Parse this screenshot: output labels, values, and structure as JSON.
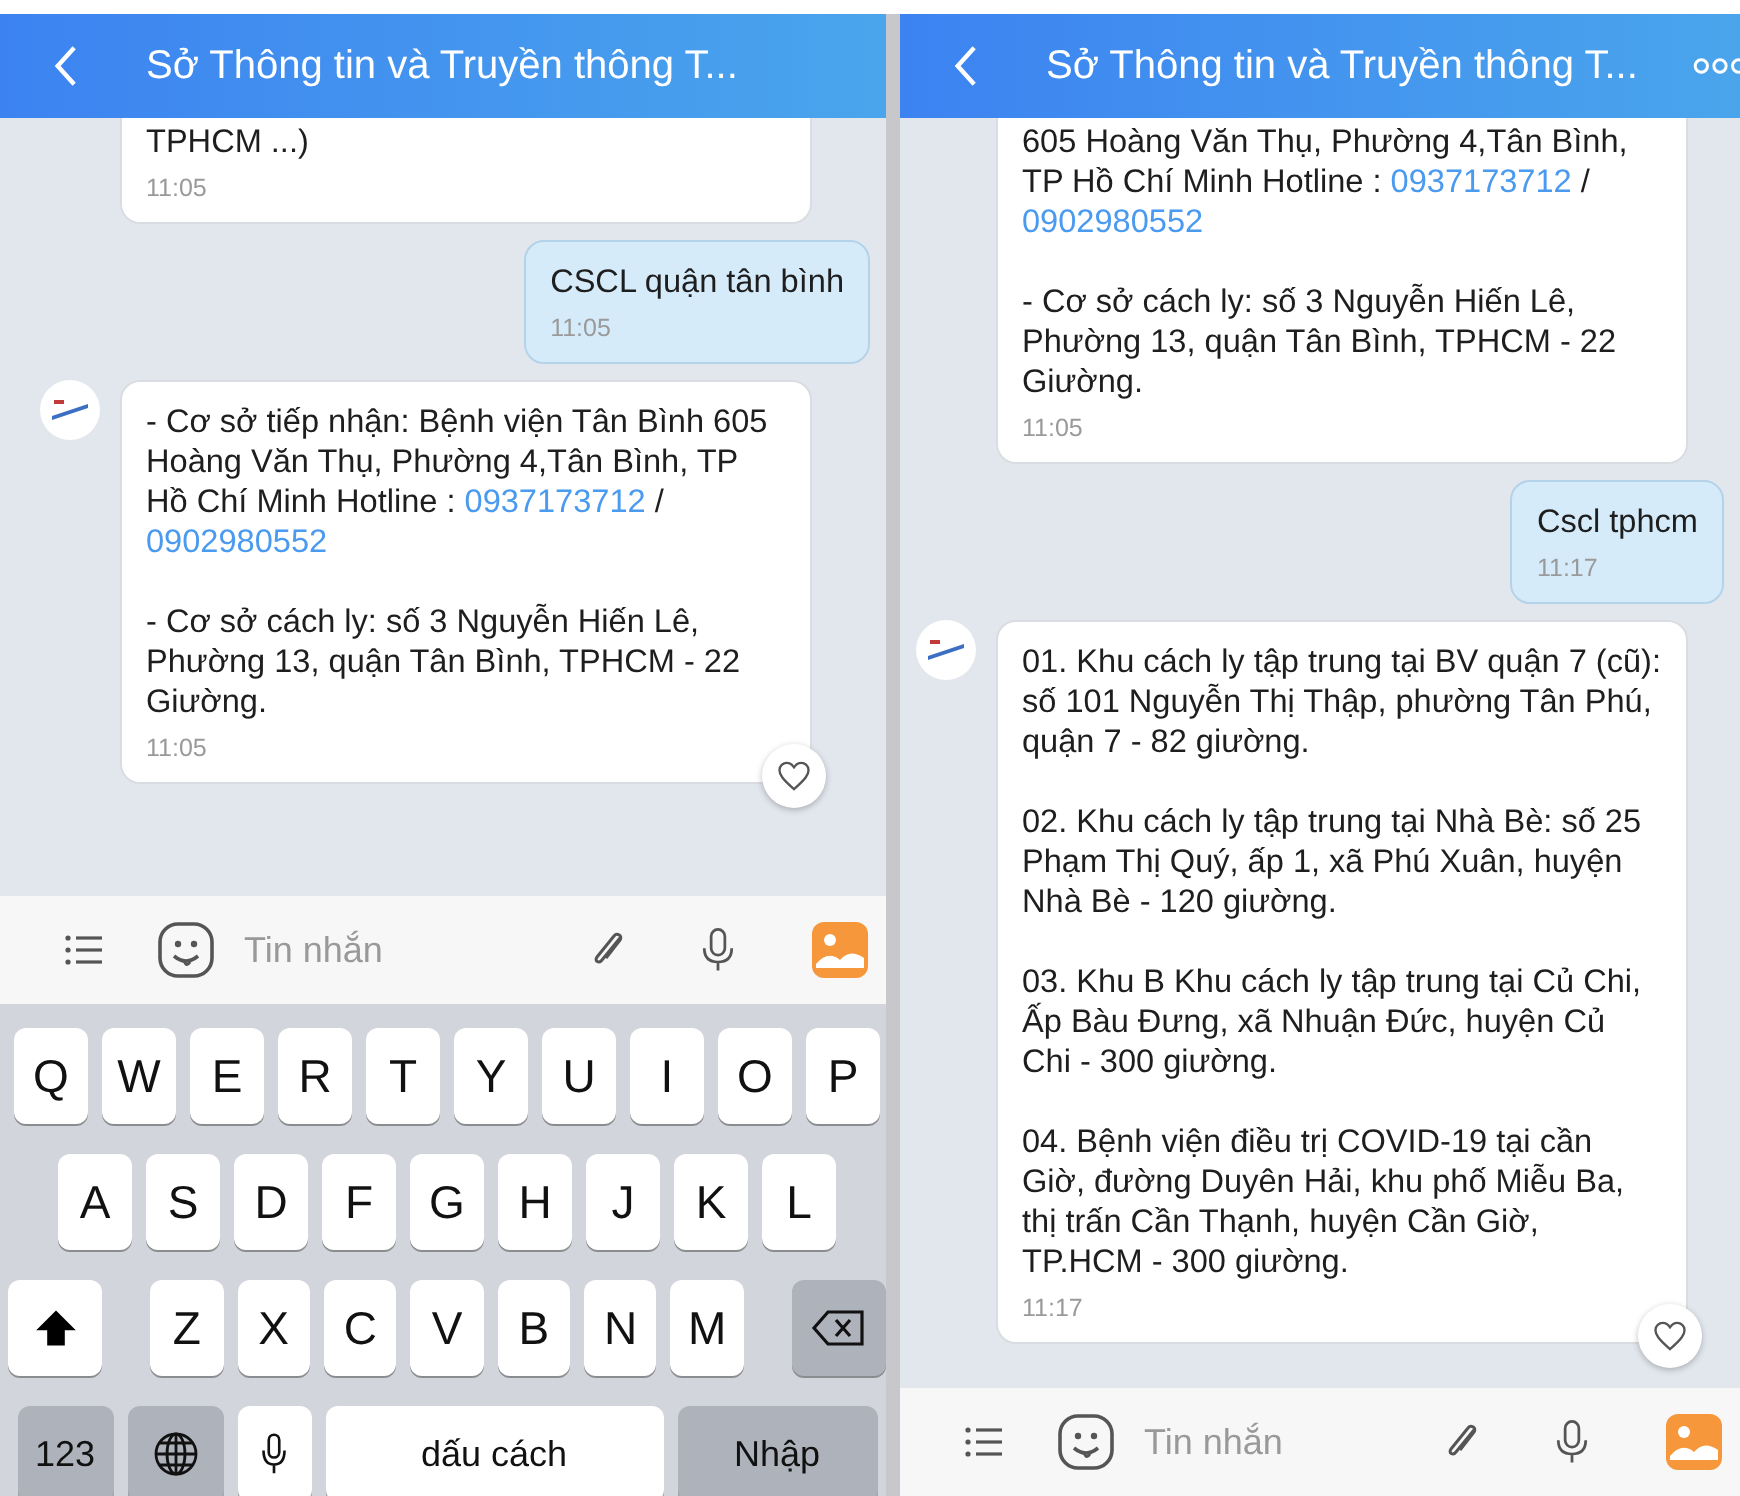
{
  "panes": [
    {
      "header": {
        "title": "Sở Thông tin và Truyền thông T..."
      },
      "messages": [
        {
          "kind": "incoming",
          "avatar": false,
          "clipped": true,
          "paragraphs": [
            [
              {
                "kind": "text",
                "text": "TPHCM ...)"
              }
            ]
          ],
          "time": "11:05",
          "like_button": false
        },
        {
          "kind": "outgoing",
          "avatar": false,
          "clipped": false,
          "paragraphs": [
            [
              {
                "kind": "text",
                "text": "CSCL quận tân bình"
              }
            ]
          ],
          "time": "11:05",
          "like_button": false
        },
        {
          "kind": "incoming",
          "avatar": true,
          "clipped": false,
          "paragraphs": [
            [
              {
                "kind": "text",
                "text": "- Cơ sở tiếp nhận: Bệnh viện Tân Bình 605 Hoàng Văn Thụ, Phường 4,Tân Bình, TP Hồ Chí Minh Hotline : "
              },
              {
                "kind": "link",
                "text": "0937173712"
              },
              {
                "kind": "text",
                "text": " / "
              },
              {
                "kind": "link",
                "text": "0902980552"
              }
            ],
            [
              {
                "kind": "text",
                "text": "- Cơ sở cách ly: số 3 Nguyễn Hiến Lê, Phường 13, quận Tân Bình, TPHCM - 22 Giường."
              }
            ]
          ],
          "time": "11:05",
          "like_button": true
        }
      ],
      "composer": {
        "placeholder": "Tin nhắn"
      },
      "keyboard": {
        "rows": [
          {
            "keys": [
              {
                "kind": "letter",
                "label": "Q"
              },
              {
                "kind": "letter",
                "label": "W"
              },
              {
                "kind": "letter",
                "label": "E"
              },
              {
                "kind": "letter",
                "label": "R"
              },
              {
                "kind": "letter",
                "label": "T"
              },
              {
                "kind": "letter",
                "label": "Y"
              },
              {
                "kind": "letter",
                "label": "U"
              },
              {
                "kind": "letter",
                "label": "I"
              },
              {
                "kind": "letter",
                "label": "O"
              },
              {
                "kind": "letter",
                "label": "P"
              }
            ]
          },
          {
            "keys": [
              {
                "kind": "letter",
                "label": "A"
              },
              {
                "kind": "letter",
                "label": "S"
              },
              {
                "kind": "letter",
                "label": "D"
              },
              {
                "kind": "letter",
                "label": "F"
              },
              {
                "kind": "letter",
                "label": "G"
              },
              {
                "kind": "letter",
                "label": "H"
              },
              {
                "kind": "letter",
                "label": "J"
              },
              {
                "kind": "letter",
                "label": "K"
              },
              {
                "kind": "letter",
                "label": "L"
              }
            ]
          },
          {
            "keys": [
              {
                "kind": "shift"
              },
              {
                "kind": "letter",
                "label": "Z"
              },
              {
                "kind": "letter",
                "label": "X"
              },
              {
                "kind": "letter",
                "label": "C"
              },
              {
                "kind": "letter",
                "label": "V"
              },
              {
                "kind": "letter",
                "label": "B"
              },
              {
                "kind": "letter",
                "label": "N"
              },
              {
                "kind": "letter",
                "label": "M"
              },
              {
                "kind": "delete"
              }
            ]
          },
          {
            "keys": [
              {
                "kind": "mode",
                "label": "123"
              },
              {
                "kind": "globe"
              },
              {
                "kind": "dictation"
              },
              {
                "kind": "space",
                "label": "dấu cách"
              },
              {
                "kind": "return",
                "label": "Nhập"
              }
            ]
          }
        ]
      }
    },
    {
      "header": {
        "title": "Sở Thông tin và Truyền thông T..."
      },
      "messages": [
        {
          "kind": "incoming",
          "avatar": false,
          "clipped": true,
          "paragraphs": [
            [
              {
                "kind": "text",
                "text": "605 Hoàng Văn Thụ, Phường 4,Tân Bình, TP Hồ Chí Minh Hotline : "
              },
              {
                "kind": "link",
                "text": "0937173712"
              },
              {
                "kind": "text",
                "text": " / "
              },
              {
                "kind": "link",
                "text": "0902980552"
              }
            ],
            [
              {
                "kind": "text",
                "text": "- Cơ sở cách ly: số 3 Nguyễn Hiến Lê, Phường 13, quận Tân Bình, TPHCM - 22 Giường."
              }
            ]
          ],
          "time": "11:05",
          "like_button": false
        },
        {
          "kind": "outgoing",
          "avatar": false,
          "clipped": false,
          "paragraphs": [
            [
              {
                "kind": "text",
                "text": "Cscl tphcm"
              }
            ]
          ],
          "time": "11:17",
          "like_button": false
        },
        {
          "kind": "incoming",
          "avatar": true,
          "clipped": false,
          "paragraphs": [
            [
              {
                "kind": "text",
                "text": "01. Khu cách ly tập trung tại BV quận 7 (cũ): số 101 Nguyễn Thị Thập, phường Tân Phú, quận 7 - 82 giường."
              }
            ],
            [
              {
                "kind": "text",
                "text": "02. Khu cách ly tập trung tại Nhà Bè: số 25 Phạm Thị Quý, ấp 1, xã Phú Xuân, huyện Nhà Bè - 120 giường."
              }
            ],
            [
              {
                "kind": "text",
                "text": "03. Khu B Khu cách ly tập trung tại Củ Chi, Ấp Bàu Đưng, xã Nhuận Đức, huyện Củ Chi - 300 giường."
              }
            ],
            [
              {
                "kind": "text",
                "text": "04. Bệnh viện điều trị COVID-19 tại cần Giờ, đường Duyên Hải, khu phố Miễu Ba, thị trấn Cần Thạnh, huyện Cần Giờ, TP.HCM - 300 giường."
              }
            ]
          ],
          "time": "11:17",
          "like_button": true
        }
      ],
      "composer": {
        "placeholder": "Tin nhắn"
      }
    }
  ]
}
